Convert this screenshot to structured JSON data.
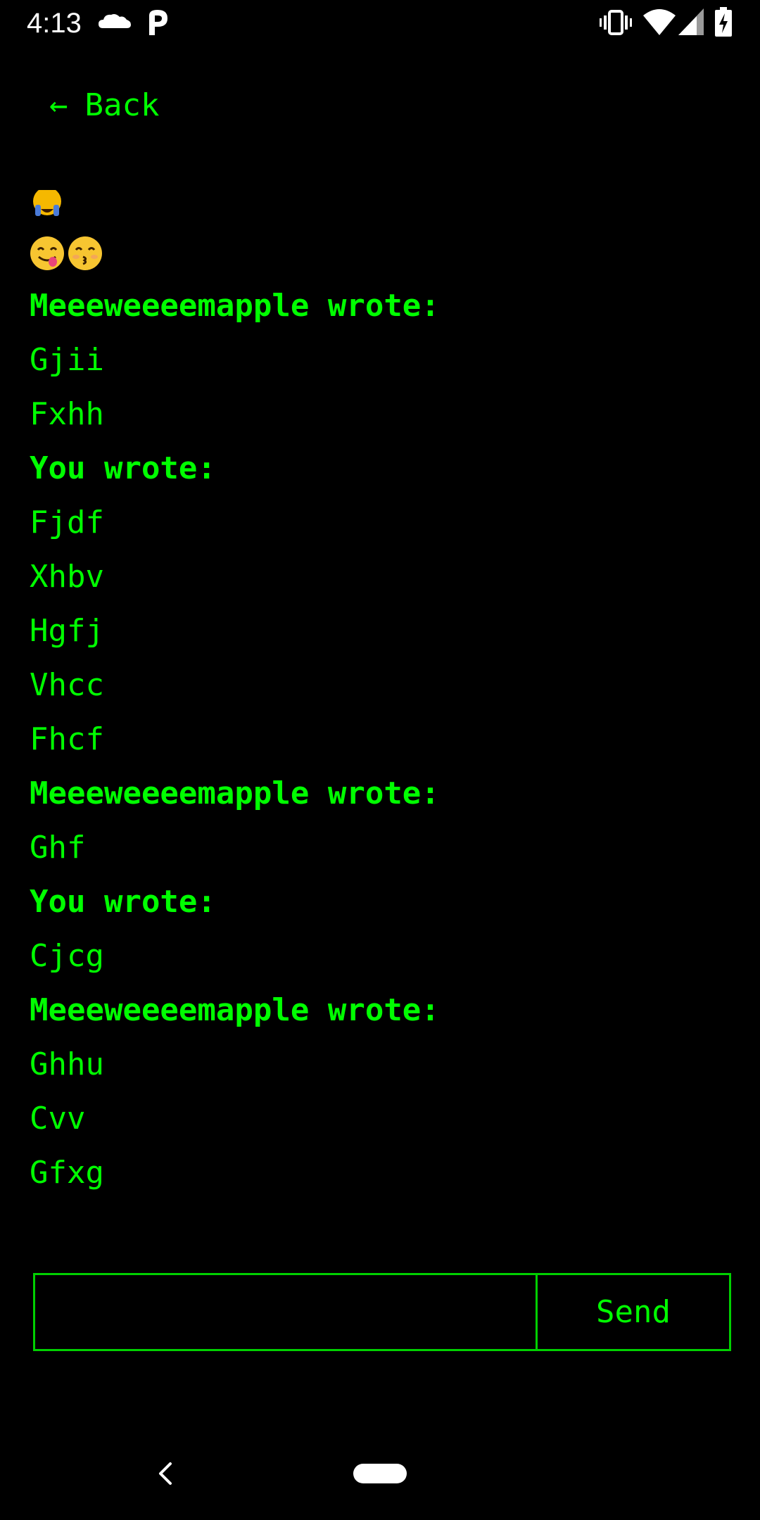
{
  "status_bar": {
    "time": "4:13",
    "icons": [
      "cloud-icon",
      "p-app-icon",
      "vibrate-icon",
      "wifi-icon",
      "signal-icon",
      "battery-charging-icon"
    ]
  },
  "nav": {
    "back_arrow": "←",
    "back_label": "Back"
  },
  "emojis": {
    "row1": [
      "party-face-emoji"
    ],
    "row2": [
      "yum-face-emoji",
      "kissing-face-emoji"
    ]
  },
  "messages": [
    {
      "type": "author",
      "text": "Meeeweeeemapple wrote:"
    },
    {
      "type": "text",
      "text": "Gjii"
    },
    {
      "type": "text",
      "text": "Fxhh"
    },
    {
      "type": "author",
      "text": "You wrote:"
    },
    {
      "type": "text",
      "text": "Fjdf"
    },
    {
      "type": "text",
      "text": "Xhbv"
    },
    {
      "type": "text",
      "text": "Hgfj"
    },
    {
      "type": "text",
      "text": "Vhcc"
    },
    {
      "type": "text",
      "text": "Fhcf"
    },
    {
      "type": "author",
      "text": "Meeeweeeemapple wrote:"
    },
    {
      "type": "text",
      "text": "Ghf"
    },
    {
      "type": "author",
      "text": "You wrote:"
    },
    {
      "type": "text",
      "text": "Cjcg"
    },
    {
      "type": "author",
      "text": "Meeeweeeemapple wrote:"
    },
    {
      "type": "text",
      "text": "Ghhu"
    },
    {
      "type": "text",
      "text": "Cvv"
    },
    {
      "type": "text",
      "text": "Gfxg"
    }
  ],
  "composer": {
    "input_value": "",
    "send_label": "Send"
  },
  "colors": {
    "background": "#000000",
    "accent": "#00ff00",
    "status_text": "#ffffff"
  }
}
